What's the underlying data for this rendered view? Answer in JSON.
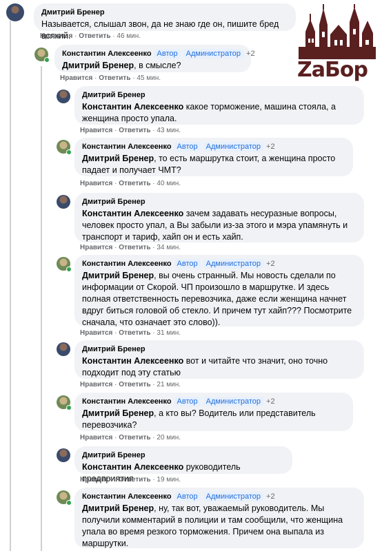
{
  "brand": {
    "logo_text": "ZaБор",
    "color": "#5a1f1f"
  },
  "actions": {
    "like": "Нравится",
    "reply": "Ответить",
    "sep": "·"
  },
  "comments": [
    {
      "author": "Дмитрий Бренер",
      "mention": "",
      "text": "Называется, слышал звон, да не знаю где он, пишите бред всякий.",
      "time": "46 мин."
    },
    {
      "author": "Константин Алексеенко",
      "badges": [
        "Автор",
        "Администратор",
        "+2"
      ],
      "mention": "Дмитрий Бренер",
      "text": ", в смысле?",
      "time": "45 мин."
    },
    {
      "author": "Дмитрий Бренер",
      "mention": "Константин Алексеенко",
      "text": "какое торможение, машина стояла, а женщина просто упала.",
      "time": "43 мин."
    },
    {
      "author": "Константин Алексеенко",
      "badges": [
        "Автор",
        "Администратор",
        "+2"
      ],
      "mention": "Дмитрий Бренер",
      "text": ", то есть маршрутка стоит, а женщина просто падает и получает ЧМТ?",
      "time": "40 мин."
    },
    {
      "author": "Дмитрий Бренер",
      "mention": "Константин Алексеенко",
      "text": "зачем задавать несуразные вопросы, человек просто упал, а Вы забыли из-за этого и мэра упамянуть и транспорт и тариф, хайп он и есть хайп.",
      "time": "34 мин."
    },
    {
      "author": "Константин Алексеенко",
      "badges": [
        "Автор",
        "Администратор",
        "+2"
      ],
      "mention": "Дмитрий Бренер",
      "text": ", вы очень странный. Мы новость сделали по информации от Скорой. ЧП произошло в маршрутке. И здесь полная ответственность перевозчика, даже если женщина начнет вдруг биться головой об стекло. И причем тут хайп??? Посмотрите сначала, что означает это слово)).",
      "time": "31 мин."
    },
    {
      "author": "Дмитрий Бренер",
      "mention": "Константин Алексеенко",
      "text": "вот и читайте что значит, оно точно подходит под эту статью",
      "time": "21 мин."
    },
    {
      "author": "Константин Алексеенко",
      "badges": [
        "Автор",
        "Администратор",
        "+2"
      ],
      "mention": "Дмитрий Бренер",
      "text": ", а кто вы? Водитель или представитель перевозчика?",
      "time": "20 мин."
    },
    {
      "author": "Дмитрий Бренер",
      "mention": "Константин Алексеенко",
      "text": "руководитель предприятия",
      "time": "19 мин."
    },
    {
      "author": "Константин Алексеенко",
      "badges": [
        "Автор",
        "Администратор",
        "+2"
      ],
      "mention": "Дмитрий Бренер",
      "text": ", ну, так вот, уважаемый руководитель. Мы получили комментарий в полиции и там сообщили, что женщина упала во время резкого торможения. Причем она выпала из маршрутки.",
      "time": ""
    }
  ]
}
